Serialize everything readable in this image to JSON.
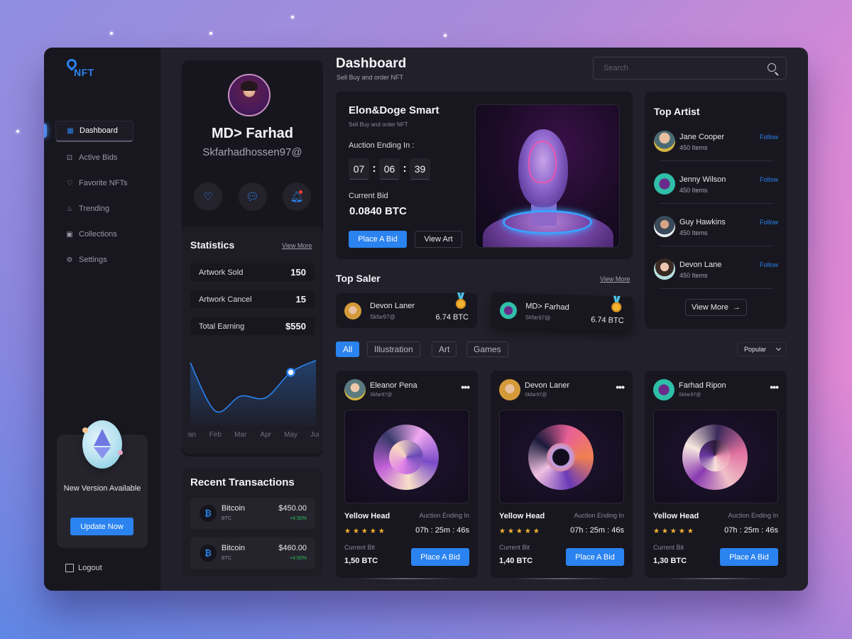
{
  "app": {
    "logo_text": "NFT",
    "page_title": "Dashboard",
    "page_subtitle": "Sell Buy and order NFT",
    "accent_color": "#2a83ef"
  },
  "search": {
    "placeholder": "Search",
    "value": ""
  },
  "sidebar": {
    "items": [
      {
        "label": "Dashboard",
        "icon": "grid-icon",
        "active": true
      },
      {
        "label": "Active Bids",
        "icon": "activity-icon",
        "active": false
      },
      {
        "label": "Favorite NFTs",
        "icon": "heart-icon",
        "active": false
      },
      {
        "label": "Trending",
        "icon": "fire-icon",
        "active": false
      },
      {
        "label": "Collections",
        "icon": "image-icon",
        "active": false
      },
      {
        "label": "Settings",
        "icon": "gear-icon",
        "active": false
      }
    ],
    "update_card": {
      "text": "New Version Available",
      "button": "Update Now"
    },
    "logout": "Logout"
  },
  "profile": {
    "name": "MD> Farhad",
    "email": "Skfarhadhossen97@",
    "actions": [
      "heart-icon",
      "chat-icon",
      "bell-icon"
    ]
  },
  "statistics": {
    "title": "Statistics",
    "view_more": "View More",
    "rows": [
      {
        "label": "Artwork Sold",
        "value": "150"
      },
      {
        "label": "Artwork Cancel",
        "value": "15"
      },
      {
        "label": "Total Earning",
        "value": "$550"
      }
    ]
  },
  "chart_data": {
    "type": "area",
    "title": "",
    "categories": [
      "Jan",
      "Feb",
      "Mar",
      "Apr",
      "May",
      "Jun"
    ],
    "values": [
      85,
      20,
      40,
      38,
      72,
      88
    ],
    "highlight_index": 4,
    "ylim": [
      0,
      100
    ],
    "xlabel": "",
    "ylabel": "",
    "grid": false,
    "line_color": "#2a83ef"
  },
  "transactions": {
    "title": "Recent Transactions",
    "items": [
      {
        "name": "Bitcoin",
        "symbol": "BTC",
        "amount": "$450.00",
        "change": "+4.50%"
      },
      {
        "name": "Bitcoin",
        "symbol": "BTC",
        "amount": "$460.00",
        "change": "+4.50%"
      }
    ]
  },
  "featured": {
    "title": "Elon&Doge Smart",
    "subtitle": "Sell Buy and order NFT",
    "auction_label": "Auction Ending In :",
    "timer": [
      "07",
      "06",
      "39"
    ],
    "bid_label": "Current Bid",
    "bid_value": "0.0840 BTC",
    "place_bid": "Place A Bid",
    "view_art": "View Art"
  },
  "top_artist": {
    "title": "Top Artist",
    "artists": [
      {
        "name": "Jane Cooper",
        "items": "450 Items",
        "action": "Follow"
      },
      {
        "name": "Jenny Wilson",
        "items": "450 Items",
        "action": "Follow"
      },
      {
        "name": "Guy Hawkins",
        "items": "450 Items",
        "action": "Follow"
      },
      {
        "name": "Devon Lane",
        "items": "450 Items",
        "action": "Follow"
      }
    ],
    "view_more": "View More"
  },
  "top_saler": {
    "title": "Top Saler",
    "view_more": "View More",
    "items": [
      {
        "name": "Devon Laner",
        "handle": "Skfar97@",
        "amount": "6.74 BTC"
      },
      {
        "name": "MD> Farhad",
        "handle": "Skfar97@",
        "amount": "6.74 BTC"
      }
    ]
  },
  "filters": {
    "tabs": [
      "All",
      "Illustration",
      "Art",
      "Games"
    ],
    "active": "All",
    "sort": "Popular"
  },
  "nfts": [
    {
      "owner": "Eleanor Pena",
      "handle": "Skfar97@",
      "title": "Yellow Head",
      "rating": 5,
      "auction_label": "Auction Ending In",
      "time": "07h : 25m : 46s",
      "bid_label": "Current Bit",
      "bid": "1,50 BTC",
      "button": "Place A Bid"
    },
    {
      "owner": "Devon Laner",
      "handle": "Skfar97@",
      "title": "Yellow Head",
      "rating": 5,
      "auction_label": "Auction Ending In",
      "time": "07h : 25m : 46s",
      "bid_label": "Current Bit",
      "bid": "1,40 BTC",
      "button": "Place A Bid"
    },
    {
      "owner": "Farhad Ripon",
      "handle": "Skfar97@",
      "title": "Yellow Head",
      "rating": 5,
      "auction_label": "Auction Ending In",
      "time": "07h : 25m : 46s",
      "bid_label": "Current Bit",
      "bid": "1,30 BTC",
      "button": "Place A Bid"
    }
  ]
}
